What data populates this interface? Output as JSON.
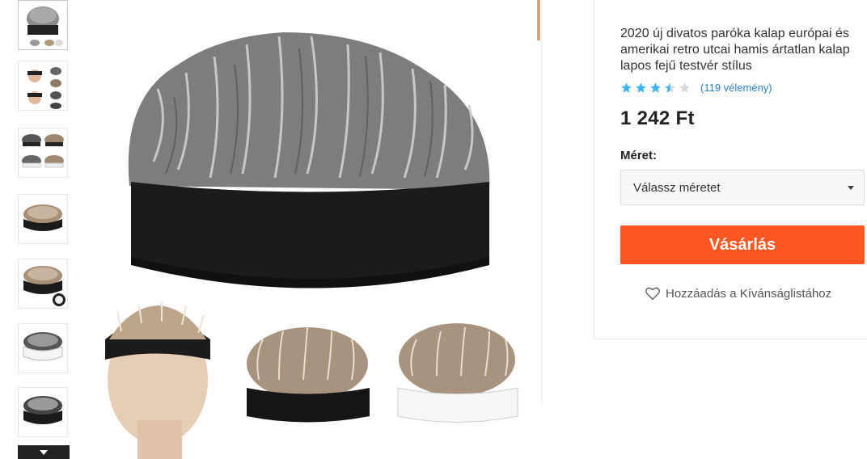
{
  "thumbnails": [
    {
      "name": "thumb-1-gray-wig-hat",
      "active": true
    },
    {
      "name": "thumb-2-mannequin-grid"
    },
    {
      "name": "thumb-3-color-variants"
    },
    {
      "name": "thumb-4-brown-wig-hat"
    },
    {
      "name": "thumb-5-brown-wig-hat-angle"
    },
    {
      "name": "thumb-6-gray-white-band"
    },
    {
      "name": "thumb-7-gray-black-band"
    }
  ],
  "product": {
    "title": "2020 új divatos paróka kalap európai és amerikai retro utcai hamis ártatlan kalap lapos fejű testvér stílus",
    "rating": 3.5,
    "reviews_label": "(119 vélemény)",
    "price": "1 242 Ft",
    "size_label": "Méret:",
    "size_placeholder": "Válassz méretet",
    "buy_label": "Vásárlás",
    "wishlist_label": "Hozzáadás a Kívánságlistához"
  },
  "colors": {
    "accent": "#ff5722",
    "star": "#3fb3f0",
    "star_empty": "#d6d6d6",
    "link": "#2d7fbf"
  }
}
